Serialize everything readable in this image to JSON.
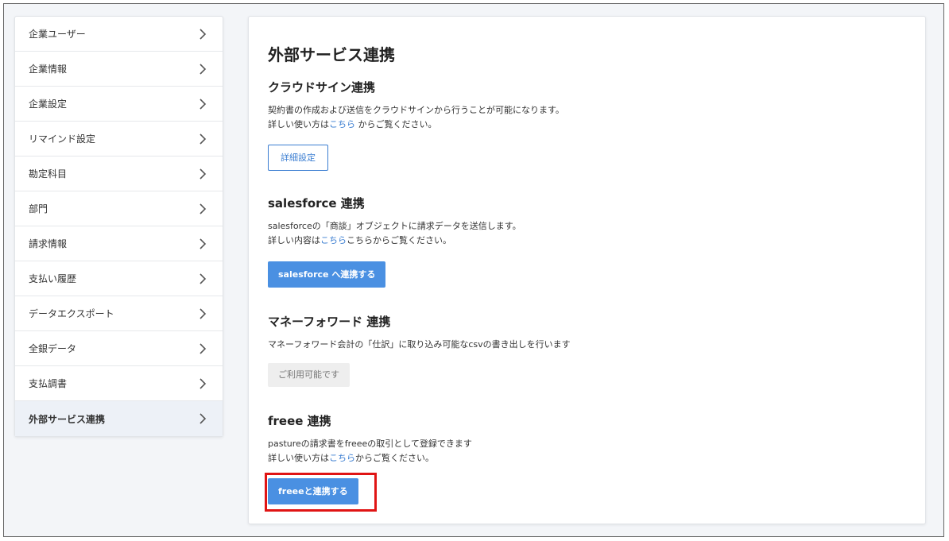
{
  "sidebar": {
    "items": [
      {
        "label": "企業ユーザー"
      },
      {
        "label": "企業情報"
      },
      {
        "label": "企業設定"
      },
      {
        "label": "リマインド設定"
      },
      {
        "label": "勘定科目"
      },
      {
        "label": "部門"
      },
      {
        "label": "請求情報"
      },
      {
        "label": "支払い履歴"
      },
      {
        "label": "データエクスポート"
      },
      {
        "label": "全銀データ"
      },
      {
        "label": "支払調書"
      },
      {
        "label": "外部サービス連携",
        "active": true
      }
    ]
  },
  "main": {
    "title": "外部サービス連携",
    "cloudsign": {
      "title": "クラウドサイン連携",
      "desc1": "契約書の作成および送信をクラウドサインから行うことが可能になります。",
      "desc2_prefix": "詳しい使い方は",
      "desc2_link": "こちら",
      "desc2_suffix": " からご覧ください。",
      "button": "詳細設定"
    },
    "salesforce": {
      "title": "salesforce 連携",
      "desc1": "salesforceの「商談」オブジェクトに請求データを送信します。",
      "desc2_prefix": "詳しい内容は",
      "desc2_link": "こちら",
      "desc2_suffix": "こちらからご覧ください。",
      "button": "salesforce へ連携する"
    },
    "moneyforward": {
      "title": "マネーフォワード 連携",
      "desc1": "マネーフォワード会計の「仕訳」に取り込み可能なcsvの書き出しを行います",
      "button": "ご利用可能です"
    },
    "freee": {
      "title": "freee 連携",
      "desc1": "pastureの請求書をfreeeの取引として登録できます",
      "desc2_prefix": "詳しい使い方は",
      "desc2_link": "こちら",
      "desc2_suffix": "からご覧ください。",
      "button": "freeeと連携する"
    }
  },
  "colors": {
    "accent": "#4a90e2",
    "link": "#3a7dd1",
    "highlight": "#e01414"
  },
  "icons": {
    "sidebar_chevron": "chevron-right-icon"
  }
}
